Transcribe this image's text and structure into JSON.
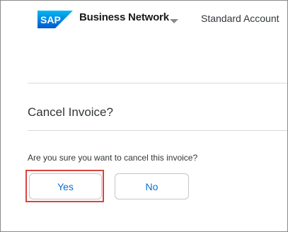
{
  "header": {
    "logo_text": "SAP",
    "brand": "Business Network",
    "account": "Standard Account"
  },
  "dialog": {
    "title": "Cancel Invoice?",
    "message": "Are you sure you want to cancel this invoice?",
    "yes_label": "Yes",
    "no_label": "No"
  },
  "colors": {
    "sap_blue": "#0a6ed1",
    "highlight_red": "#d9453f"
  }
}
